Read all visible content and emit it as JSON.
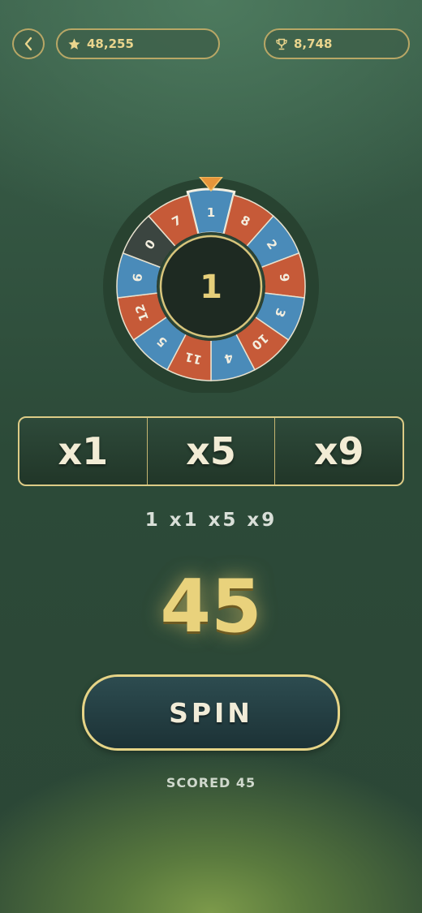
{
  "header": {
    "back_icon": "chevron-left-icon",
    "stars": {
      "icon": "star-icon",
      "value": "48,255"
    },
    "trophies": {
      "icon": "trophy-icon",
      "value": "8,748"
    }
  },
  "wheel": {
    "center_value": "1",
    "pointer_icon": "triangle-down-icon",
    "highlighted_segment": "1",
    "segments": [
      {
        "label": "1",
        "color": "#4a8bb9"
      },
      {
        "label": "8",
        "color": "#c65a38"
      },
      {
        "label": "2",
        "color": "#4a8bb9"
      },
      {
        "label": "9",
        "color": "#c65a38"
      },
      {
        "label": "3",
        "color": "#4a8bb9"
      },
      {
        "label": "10",
        "color": "#c65a38"
      },
      {
        "label": "4",
        "color": "#4a8bb9"
      },
      {
        "label": "11",
        "color": "#c65a38"
      },
      {
        "label": "5",
        "color": "#4a8bb9"
      },
      {
        "label": "12",
        "color": "#c65a38"
      },
      {
        "label": "6",
        "color": "#4a8bb9"
      },
      {
        "label": "0",
        "color": "#3b4540"
      },
      {
        "label": "7",
        "color": "#c65a38"
      }
    ]
  },
  "multipliers": [
    "x1",
    "x5",
    "x9"
  ],
  "formula": "1 x1 x5 x9",
  "score": "45",
  "spin_label": "SPIN",
  "status": "SCORED 45",
  "colors": {
    "gold": "#e9d27c",
    "blue": "#4a8bb9",
    "red": "#c65a38",
    "dark": "#3b4540"
  }
}
